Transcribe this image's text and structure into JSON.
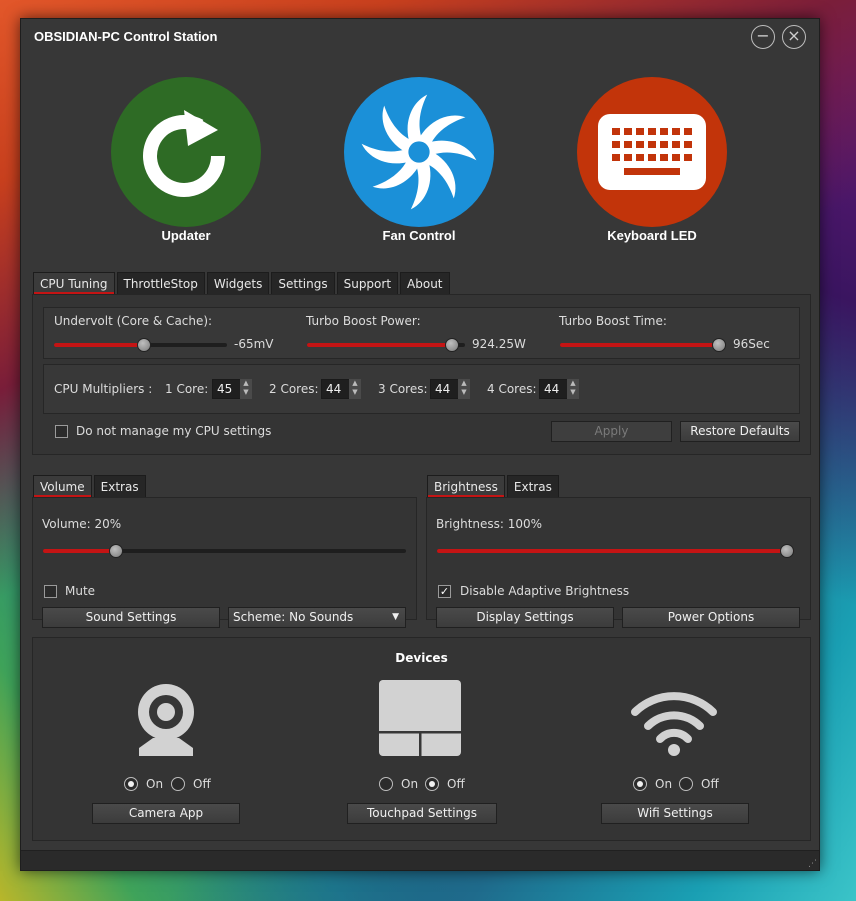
{
  "window": {
    "title": "OBSIDIAN-PC Control Station"
  },
  "launchers": [
    {
      "label": "Updater",
      "color": "#2e6b25",
      "icon": "refresh-icon"
    },
    {
      "label": "Fan Control",
      "color": "#1b90d8",
      "icon": "fan-icon"
    },
    {
      "label": "Keyboard LED",
      "color": "#c2340a",
      "icon": "keyboard-icon"
    }
  ],
  "main_tabs": [
    "CPU Tuning",
    "ThrottleStop",
    "Widgets",
    "Settings",
    "Support",
    "About"
  ],
  "cpu": {
    "undervolt": {
      "label": "Undervolt (Core & Cache):",
      "value": "-65mV",
      "level": 0.52
    },
    "turbo_power": {
      "label": "Turbo Boost Power:",
      "value": "924.25W",
      "level": 0.92
    },
    "turbo_time": {
      "label": "Turbo Boost Time:",
      "value": "96Sec",
      "level": 0.98
    },
    "multipliers_label": "CPU Multipliers :",
    "multipliers": [
      {
        "label": "1 Core:",
        "value": "45"
      },
      {
        "label": "2 Cores:",
        "value": "44"
      },
      {
        "label": "3 Cores:",
        "value": "44"
      },
      {
        "label": "4 Cores:",
        "value": "44"
      }
    ],
    "manage_label": "Do not manage my CPU settings",
    "apply_label": "Apply",
    "restore_label": "Restore Defaults"
  },
  "volume": {
    "tabs": [
      "Volume",
      "Extras"
    ],
    "label": "Volume: 20%",
    "level": 0.2,
    "mute_label": "Mute",
    "sound_settings": "Sound Settings",
    "scheme": "Scheme: No Sounds"
  },
  "brightness": {
    "tabs": [
      "Brightness",
      "Extras"
    ],
    "label": "Brightness: 100%",
    "level": 1.0,
    "adaptive_label": "Disable Adaptive Brightness",
    "display_settings": "Display Settings",
    "power_options": "Power Options"
  },
  "devices": {
    "title": "Devices",
    "on_label": "On",
    "off_label": "Off",
    "camera_button": "Camera App",
    "touchpad_button": "Touchpad Settings",
    "wifi_button": "Wifi Settings"
  },
  "colors": {
    "accent": "#c41414",
    "background": "#373737"
  }
}
